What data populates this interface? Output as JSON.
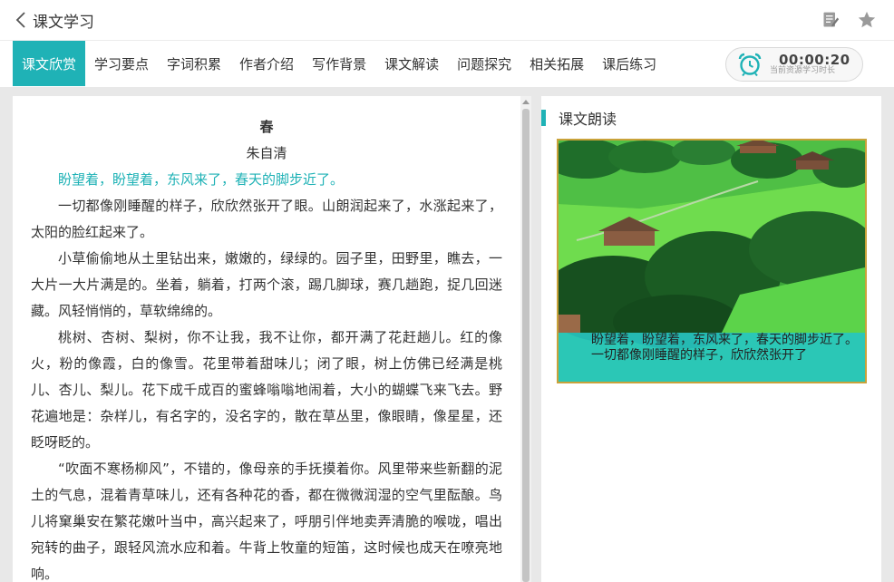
{
  "header": {
    "title": "课文学习"
  },
  "tabs": [
    "课文欣赏",
    "学习要点",
    "字词积累",
    "作者介绍",
    "写作背景",
    "课文解读",
    "问题探究",
    "相关拓展",
    "课后练习"
  ],
  "timer": {
    "value": "00:00:20",
    "caption": "当前资源学习时长"
  },
  "article": {
    "title": "春",
    "author": "朱自清",
    "paragraphs": [
      "盼望着，盼望着，东风来了，春天的脚步近了。",
      "一切都像刚睡醒的样子，欣欣然张开了眼。山朗润起来了，水涨起来了，太阳的脸红起来了。",
      "小草偷偷地从土里钻出来，嫩嫩的，绿绿的。园子里，田野里，瞧去，一大片一大片满是的。坐着，躺着，打两个滚，踢几脚球，赛几趟跑，捉几回迷藏。风轻悄悄的，草软绵绵的。",
      "桃树、杏树、梨树，你不让我，我不让你，都开满了花赶趟儿。红的像火，粉的像霞，白的像雪。花里带着甜味儿；闭了眼，树上仿佛已经满是桃儿、杏儿、梨儿。花下成千成百的蜜蜂嗡嗡地闹着，大小的蝴蝶飞来飞去。野花遍地是：杂样儿，有名字的，没名字的，散在草丛里，像眼睛，像星星，还眨呀眨的。",
      "“吹面不寒杨柳风”，不错的，像母亲的手抚摸着你。风里带来些新翻的泥土的气息，混着青草味儿，还有各种花的香，都在微微润湿的空气里酝酿。鸟儿将窠巢安在繁花嫩叶当中，高兴起来了，呼朋引伴地卖弄清脆的喉咙，唱出宛转的曲子，跟轻风流水应和着。牛背上牧童的短笛，这时候也成天在嘹亮地响。"
    ]
  },
  "reading": {
    "section_title": "课文朗读",
    "subtitle_line1": "盼望着，盼望着，东风来了，春天的脚步近了。",
    "subtitle_line2": "一切都像刚睡醒的样子，欣欣然张开了"
  },
  "colors": {
    "accent": "#1fb2b6",
    "video_border": "#c9a23a"
  },
  "icons": [
    "back-chevron-icon",
    "notes-icon",
    "star-icon",
    "alarm-clock-icon"
  ]
}
